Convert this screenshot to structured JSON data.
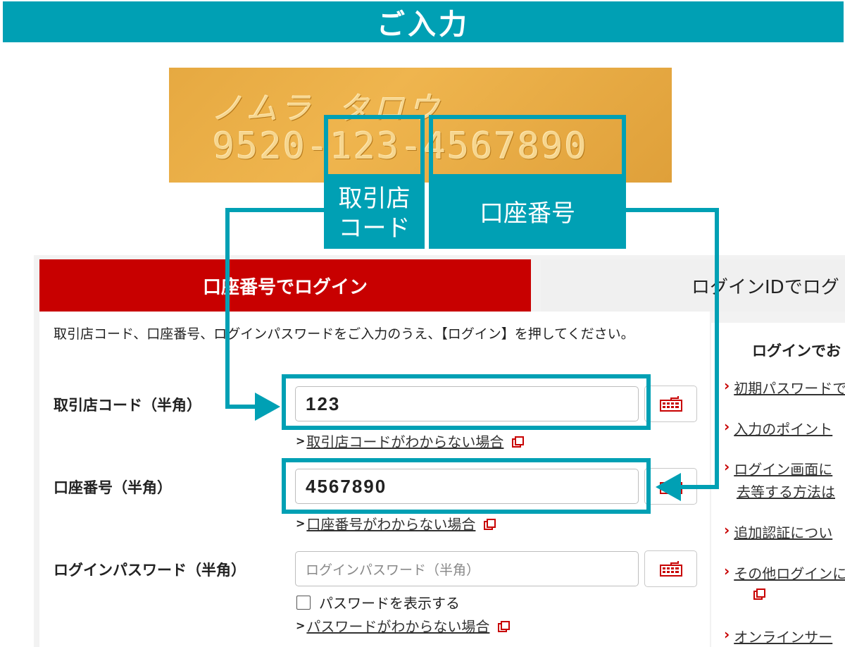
{
  "header": {
    "title": "ご入力"
  },
  "card": {
    "name": "ノムラ タロウ",
    "number": "9520-123-4567890"
  },
  "annotations": {
    "branch_label_line1": "取引店",
    "branch_label_line2": "コード",
    "account_label": "口座番号"
  },
  "tabs": {
    "active": "口座番号でログイン",
    "inactive": "ログインIDでログ"
  },
  "form": {
    "intro": "取引店コード、口座番号、ログインパスワードをご入力のうえ、【ログイン】を押してください。",
    "branch": {
      "label": "取引店コード（半角）",
      "value": "123",
      "help": "取引店コードがわからない場合"
    },
    "account": {
      "label": "口座番号（半角）",
      "value": "4567890",
      "help": "口座番号がわからない場合"
    },
    "password": {
      "label": "ログインパスワード（半角）",
      "placeholder": "ログインパスワード（半角）",
      "show_label": "パスワードを表示する",
      "help": "パスワードがわからない場合"
    },
    "help_prefix": ">"
  },
  "sidebar": {
    "title": "ログインでお",
    "items": [
      {
        "label": "初期パスワードで"
      },
      {
        "label": "入力のポイント"
      },
      {
        "label": "ログイン画面に",
        "sub": "去等する方法は"
      },
      {
        "label": "追加認証につい"
      },
      {
        "label": "その他ログインに"
      },
      {
        "label": "オンラインサー"
      }
    ]
  },
  "colors": {
    "teal": "#00a0b4",
    "red": "#c80000"
  },
  "icons": {
    "keyboard": "keyboard-icon",
    "external": "external-link-icon",
    "chevron": "chevron-right-icon"
  }
}
